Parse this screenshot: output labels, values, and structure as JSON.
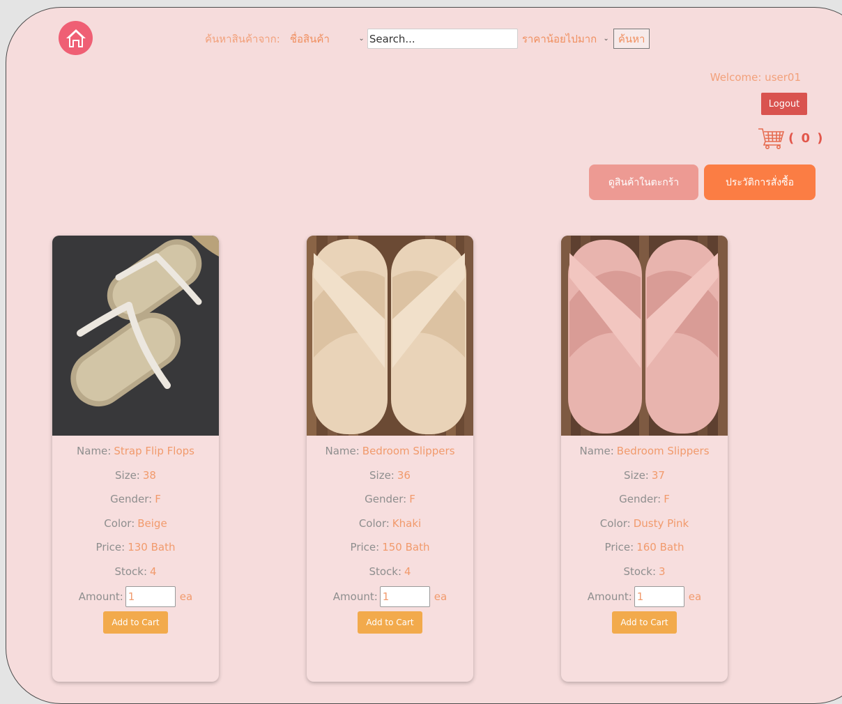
{
  "header": {
    "search_label": "ค้นหาสินค้าจาก:",
    "search_field_selected": "ชื่อสินค้า",
    "search_placeholder": "Search...",
    "sort_selected": "ราคาน้อยไปมาก",
    "search_button": "ค้นหา"
  },
  "user": {
    "welcome": "Welcome: user01",
    "logout_label": "Logout",
    "cart_count": "( 0 )"
  },
  "actions": {
    "view_cart": "ดูสินค้าในตะกร้า",
    "order_history": "ประวัติการสั่งซื้อ"
  },
  "labels": {
    "name": "Name:",
    "size": "Size:",
    "gender": "Gender:",
    "color": "Color:",
    "price": "Price:",
    "stock": "Stock:",
    "amount": "Amount:",
    "unit": "ea",
    "add_to_cart": "Add to Cart"
  },
  "products": [
    {
      "name": "Strap Flip Flops",
      "size": "38",
      "gender": "F",
      "color": "Beige",
      "price": "130 Bath",
      "stock": "4",
      "amount": "1",
      "image_icon": "strap-flip-flops-image"
    },
    {
      "name": "Bedroom Slippers",
      "size": "36",
      "gender": "F",
      "color": "Khaki",
      "price": "150 Bath",
      "stock": "4",
      "amount": "1",
      "image_icon": "khaki-fur-slippers-image"
    },
    {
      "name": "Bedroom Slippers",
      "size": "37",
      "gender": "F",
      "color": "Dusty Pink",
      "price": "160 Bath",
      "stock": "3",
      "amount": "1",
      "image_icon": "pink-fur-slippers-image"
    }
  ],
  "colors": {
    "page_bg": "#f6dcdc",
    "home_icon": "#ef5f74",
    "logout": "#d9534f",
    "view_cart": "#ed9a93",
    "history": "#fb7d44",
    "add_to_cart": "#f2aa4c",
    "value_text": "#f19a6c"
  }
}
